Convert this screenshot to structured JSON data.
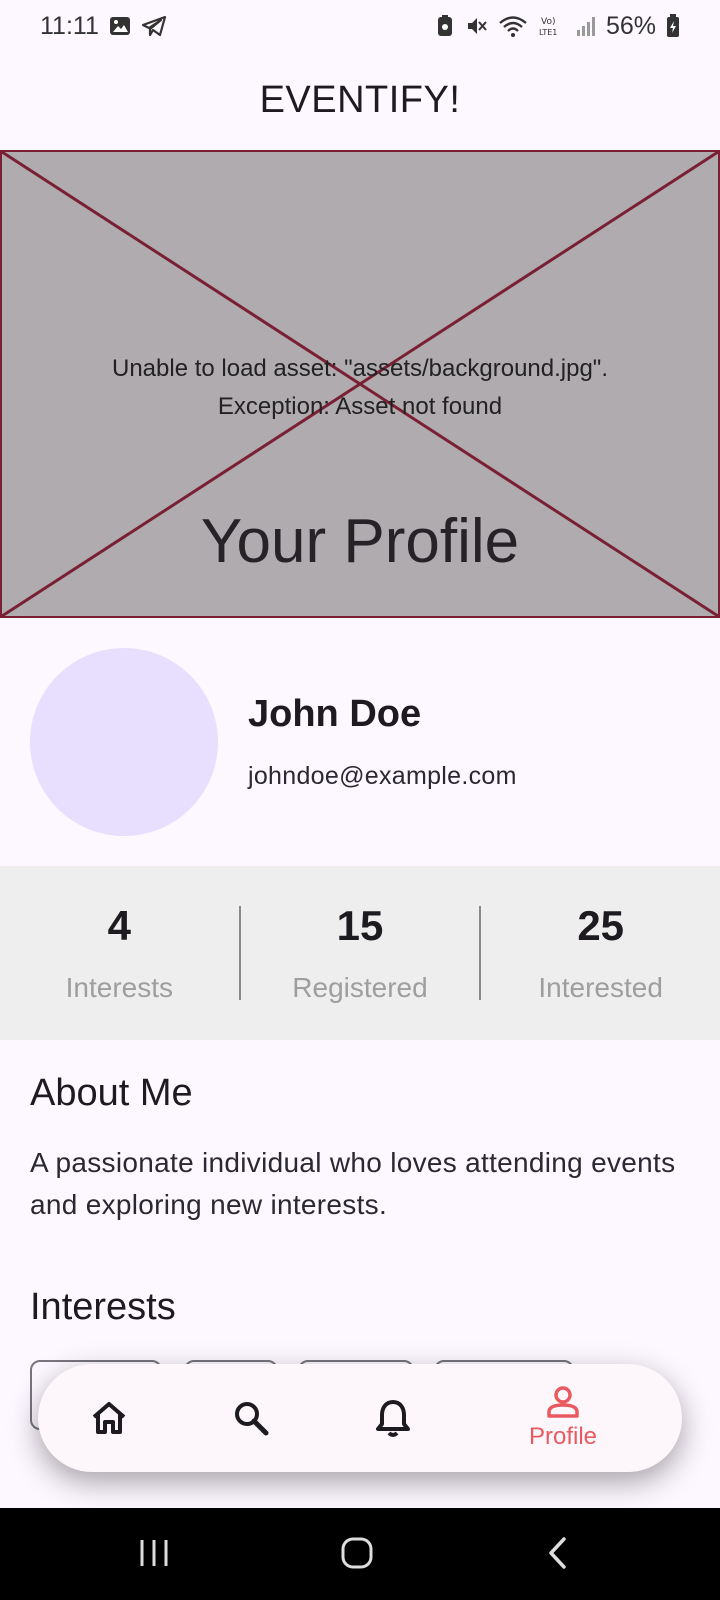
{
  "status_bar": {
    "time": "11:11",
    "battery": "56%",
    "icons_left": [
      "gallery-icon",
      "telegram-icon"
    ],
    "icons_right": [
      "battery-saver-icon",
      "mute-icon",
      "wifi-icon",
      "volte-icon",
      "signal-icon",
      "battery-icon"
    ]
  },
  "app_bar": {
    "title": "EVENTIFY!"
  },
  "hero": {
    "error_line1": "Unable to load asset: \"assets/background.jpg\".",
    "error_line2": "Exception: Asset not found",
    "title": "Your Profile"
  },
  "profile": {
    "name": "John Doe",
    "email": "johndoe@example.com"
  },
  "stats": [
    {
      "value": "4",
      "label": "Interests"
    },
    {
      "value": "15",
      "label": "Registered"
    },
    {
      "value": "25",
      "label": "Interested"
    }
  ],
  "about": {
    "heading": "About Me",
    "text": "A passionate individual who loves attending events and exploring new interests."
  },
  "interests": {
    "heading": "Interests"
  },
  "bottom_nav": {
    "items": [
      {
        "icon": "home-icon"
      },
      {
        "icon": "search-icon"
      },
      {
        "icon": "bell-icon"
      },
      {
        "icon": "person-icon",
        "label": "Profile",
        "active": true
      }
    ],
    "active_color": "#e85a5f"
  },
  "colors": {
    "background": "#fdf7ff",
    "hero_placeholder": "#b0abaf",
    "hero_border": "#7a2035",
    "avatar": "#e8defe",
    "stats_background": "#eeeeee"
  }
}
